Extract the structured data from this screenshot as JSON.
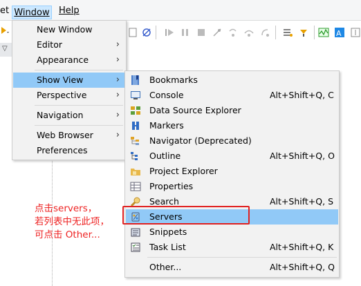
{
  "menubar": {
    "set_label": "et",
    "window_label": "Window",
    "help_label": "Help"
  },
  "window_menu": {
    "items": [
      {
        "label": "New Window",
        "submenu": false
      },
      {
        "label": "Editor",
        "submenu": true
      },
      {
        "label": "Appearance",
        "submenu": true
      },
      {
        "label": "Show View",
        "submenu": true,
        "selected": true
      },
      {
        "label": "Perspective",
        "submenu": true
      },
      {
        "label": "Navigation",
        "submenu": true
      },
      {
        "label": "Web Browser",
        "submenu": true
      },
      {
        "label": "Preferences",
        "submenu": false
      }
    ]
  },
  "show_view_menu": {
    "items": [
      {
        "label": "Bookmarks",
        "shortcut": "",
        "icon": "bookmarks-icon"
      },
      {
        "label": "Console",
        "shortcut": "Alt+Shift+Q, C",
        "icon": "console-icon"
      },
      {
        "label": "Data Source Explorer",
        "shortcut": "",
        "icon": "data-source-explorer-icon"
      },
      {
        "label": "Markers",
        "shortcut": "",
        "icon": "markers-icon"
      },
      {
        "label": "Navigator (Deprecated)",
        "shortcut": "",
        "icon": "navigator-icon"
      },
      {
        "label": "Outline",
        "shortcut": "Alt+Shift+Q, O",
        "icon": "outline-icon"
      },
      {
        "label": "Project Explorer",
        "shortcut": "",
        "icon": "project-explorer-icon"
      },
      {
        "label": "Properties",
        "shortcut": "",
        "icon": "properties-icon"
      },
      {
        "label": "Search",
        "shortcut": "Alt+Shift+Q, S",
        "icon": "search-icon"
      },
      {
        "label": "Servers",
        "shortcut": "",
        "icon": "servers-icon",
        "selected": true
      },
      {
        "label": "Snippets",
        "shortcut": "",
        "icon": "snippets-icon"
      },
      {
        "label": "Task List",
        "shortcut": "Alt+Shift+Q, K",
        "icon": "task-list-icon"
      },
      {
        "label": "Other...",
        "shortcut": "Alt+Shift+Q, Q",
        "icon": ""
      }
    ]
  },
  "annotation": {
    "line1": "点击servers，",
    "line2": "若列表中无此项，",
    "line3": "可点击 Other..."
  },
  "colors": {
    "selection": "#91c9f7",
    "menubar_active": "#cce8ff",
    "annotation_red": "#ee2222"
  }
}
